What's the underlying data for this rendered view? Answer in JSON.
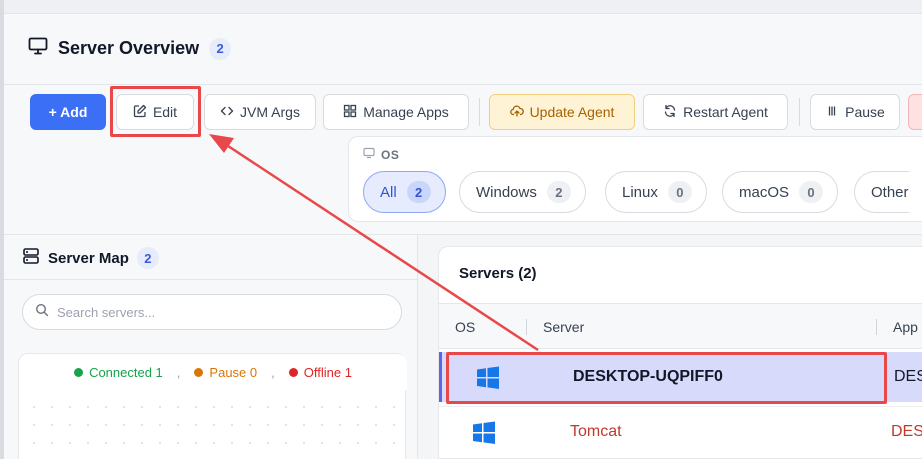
{
  "header": {
    "title": "Server Overview",
    "count": "2"
  },
  "toolbar": {
    "add_label": "+ Add",
    "edit_label": "Edit",
    "jvm_label": "JVM Args",
    "manage_label": "Manage Apps",
    "update_label": "Update Agent",
    "restart_label": "Restart Agent",
    "pause_label": "Pause"
  },
  "os_filter": {
    "label": "OS",
    "chips": [
      {
        "label": "All",
        "count": "2"
      },
      {
        "label": "Windows",
        "count": "2"
      },
      {
        "label": "Linux",
        "count": "0"
      },
      {
        "label": "macOS",
        "count": "0"
      },
      {
        "label": "Other",
        "count": ""
      }
    ]
  },
  "server_map": {
    "title": "Server Map",
    "count": "2",
    "search_placeholder": "Search servers...",
    "legend": [
      {
        "label": "Connected 1",
        "color": "#16a34a"
      },
      {
        "label": "Pause 0",
        "color": "#d97706"
      },
      {
        "label": "Offline 1",
        "color": "#dc2626"
      }
    ],
    "separator": ","
  },
  "servers": {
    "title": "Servers (2)",
    "columns": [
      "OS",
      "Server",
      "App"
    ],
    "rows": [
      {
        "os": "windows-icon",
        "name": "DESKTOP-UQPIFF0",
        "app": "DES",
        "status_color": "#111827"
      },
      {
        "os": "windows-icon",
        "name": "Tomcat",
        "app": "DES",
        "status_color": "#c0392b"
      }
    ]
  },
  "colors": {
    "accent": "#3b6ff5",
    "highlight": "#e8484a",
    "selected_row": "#d7dafb"
  }
}
